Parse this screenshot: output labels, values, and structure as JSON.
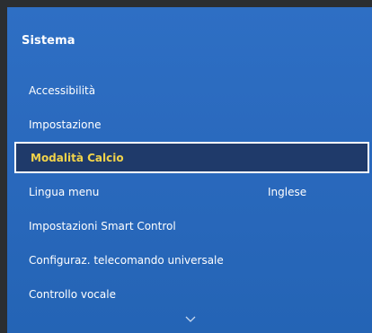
{
  "menu": {
    "title": "Sistema",
    "items": [
      {
        "label": "Accessibilità",
        "value": ""
      },
      {
        "label": "Impostazione",
        "value": ""
      },
      {
        "label": "Modalità Calcio",
        "value": ""
      },
      {
        "label": "Lingua menu",
        "value": "Inglese"
      },
      {
        "label": "Impostazioni Smart Control",
        "value": ""
      },
      {
        "label": "Configuraz. telecomando universale",
        "value": ""
      },
      {
        "label": "Controllo vocale",
        "value": ""
      }
    ],
    "selected_index": 2,
    "scroll_indicator_icon": "chevron-down-icon"
  },
  "colors": {
    "panel": "#2a69bd",
    "selected_bg": "#1f3a6a",
    "selected_text": "#f1d34a",
    "text": "#ffffff"
  }
}
